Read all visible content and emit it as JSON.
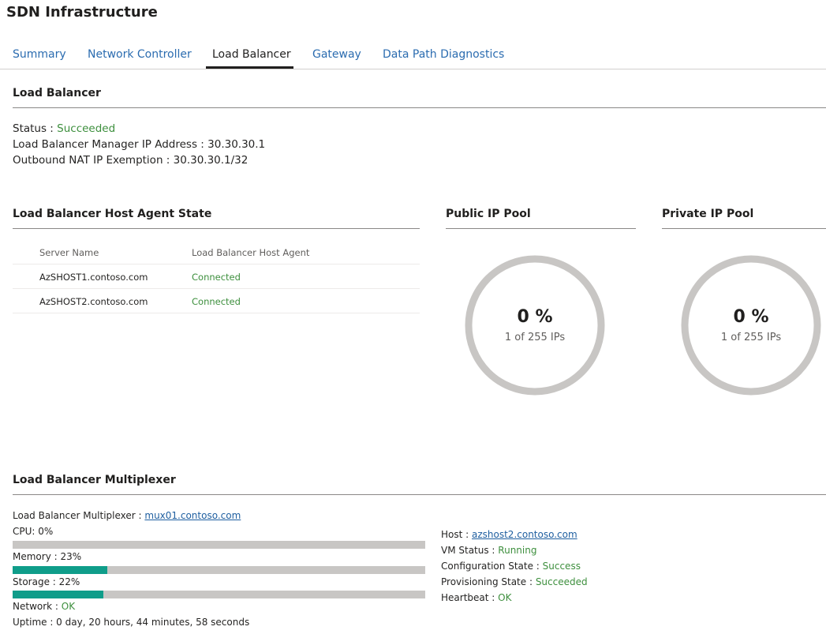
{
  "app": {
    "title": "SDN Infrastructure"
  },
  "tabs": [
    {
      "label": "Summary",
      "active": false
    },
    {
      "label": "Network Controller",
      "active": false
    },
    {
      "label": "Load Balancer",
      "active": true
    },
    {
      "label": "Gateway",
      "active": false
    },
    {
      "label": "Data Path Diagnostics",
      "active": false
    }
  ],
  "load_balancer": {
    "title": "Load Balancer",
    "status_label": "Status : ",
    "status_value": "Succeeded",
    "manager_ip_label": "Load Balancer Manager IP Address : ",
    "manager_ip_value": "30.30.30.1",
    "nat_label": "Outbound NAT IP Exemption : ",
    "nat_value": "30.30.30.1/32"
  },
  "host_agent": {
    "title": "Load Balancer Host Agent State",
    "columns": [
      "Server Name",
      "Load Balancer Host Agent"
    ],
    "rows": [
      {
        "server": "AzSHOST1.contoso.com",
        "status": "Connected"
      },
      {
        "server": "AzSHOST2.contoso.com",
        "status": "Connected"
      }
    ]
  },
  "public_pool": {
    "title": "Public IP Pool",
    "percent": "0 %",
    "usage": "1 of 255 IPs",
    "fraction": 0.0
  },
  "private_pool": {
    "title": "Private IP Pool",
    "percent": "0 %",
    "usage": "1 of 255 IPs",
    "fraction": 0.0
  },
  "mux": {
    "title": "Load Balancer Multiplexer",
    "mux_label": "Load Balancer Multiplexer : ",
    "mux_value": "mux01.contoso.com",
    "cpu_label": "CPU: 0%",
    "cpu_fraction": 0.0,
    "memory_label": "Memory : 23%",
    "memory_fraction": 0.23,
    "storage_label": "Storage : 22%",
    "storage_fraction": 0.22,
    "network_label": "Network : ",
    "network_value": "OK",
    "uptime_label": "Uptime : 0 day, 20 hours, 44 minutes, 58 seconds",
    "host_label": "Host : ",
    "host_value": "azshost2.contoso.com",
    "vm_status_label": "VM Status : ",
    "vm_status_value": "Running",
    "config_label": "Configuration State : ",
    "config_value": "Success",
    "prov_label": "Provisioning State : ",
    "prov_value": "Succeeded",
    "heartbeat_label": "Heartbeat : ",
    "heartbeat_value": "OK"
  },
  "colors": {
    "accent_link": "#1f5fa0",
    "status_ok": "#3d8f3d",
    "bar_fill": "#0f9d8a",
    "bar_track": "#c8c6c4",
    "donut_ring": "#c8c6c4"
  }
}
